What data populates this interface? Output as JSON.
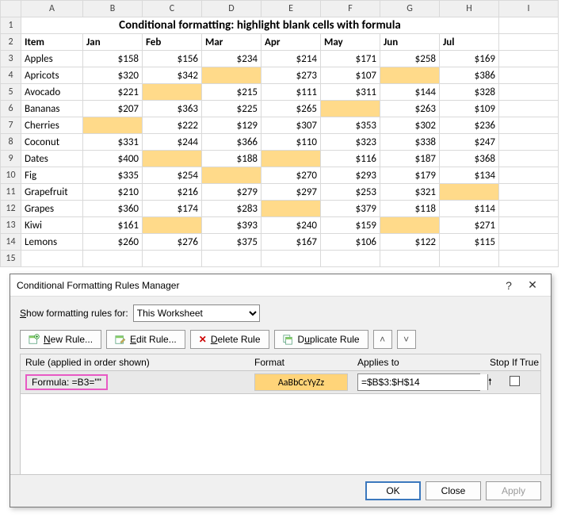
{
  "sheet": {
    "title": "Conditional formatting: highlight blank cells with formula",
    "col_letters": [
      "A",
      "B",
      "C",
      "D",
      "E",
      "F",
      "G",
      "H",
      "I"
    ],
    "row_numbers": [
      1,
      2,
      3,
      4,
      5,
      6,
      7,
      8,
      9,
      10,
      11,
      12,
      13,
      14,
      15
    ],
    "headers": {
      "item": "Item",
      "months": [
        "Jan",
        "Feb",
        "Mar",
        "Apr",
        "May",
        "Jun",
        "Jul"
      ]
    },
    "rows": [
      {
        "item": "Apples",
        "vals": [
          "$158",
          "$156",
          "$234",
          "$214",
          "$171",
          "$258",
          "$169"
        ]
      },
      {
        "item": "Apricots",
        "vals": [
          "$320",
          "$342",
          "",
          "$273",
          "$107",
          "",
          "$386"
        ]
      },
      {
        "item": "Avocado",
        "vals": [
          "$221",
          "",
          "$215",
          "$111",
          "$311",
          "$144",
          "$328"
        ]
      },
      {
        "item": "Bananas",
        "vals": [
          "$207",
          "$363",
          "$225",
          "$265",
          "",
          "$263",
          "$109"
        ]
      },
      {
        "item": "Cherries",
        "vals": [
          "",
          "$222",
          "$129",
          "$307",
          "$353",
          "$302",
          "$236"
        ]
      },
      {
        "item": "Coconut",
        "vals": [
          "$331",
          "$244",
          "$366",
          "$110",
          "$323",
          "$338",
          "$247"
        ]
      },
      {
        "item": "Dates",
        "vals": [
          "$400",
          "",
          "$188",
          "",
          "$116",
          "$187",
          "$368"
        ]
      },
      {
        "item": "Fig",
        "vals": [
          "$335",
          "$254",
          "",
          "$270",
          "$293",
          "$179",
          "$134"
        ]
      },
      {
        "item": "Grapefruit",
        "vals": [
          "$210",
          "$216",
          "$279",
          "$297",
          "$253",
          "$321",
          ""
        ]
      },
      {
        "item": "Grapes",
        "vals": [
          "$360",
          "$174",
          "$283",
          "",
          "$379",
          "$118",
          "$114"
        ]
      },
      {
        "item": "Kiwi",
        "vals": [
          "$161",
          "",
          "$393",
          "$240",
          "$159",
          "",
          "$271"
        ]
      },
      {
        "item": "Lemons",
        "vals": [
          "$260",
          "$276",
          "$375",
          "$167",
          "$106",
          "$122",
          "$115"
        ]
      }
    ]
  },
  "dialog": {
    "title": "Conditional Formatting Rules Manager",
    "show_label_pre": "S",
    "show_label_mid": "how formatting rules for:",
    "scope_value": "This Worksheet",
    "buttons": {
      "new": "New Rule...",
      "edit": "Edit Rule...",
      "delete": "Delete Rule",
      "duplicate": "Duplicate Rule"
    },
    "columns": {
      "rule": "Rule (applied in order shown)",
      "format": "Format",
      "applies": "Applies to",
      "stop": "Stop If True"
    },
    "rule": {
      "formula_text": "Formula: =B3=\"\"",
      "format_preview": "AaBbCcYyZz",
      "applies_to": "=$B$3:$H$14"
    },
    "footer": {
      "ok": "OK",
      "close": "Close",
      "apply": "Apply"
    }
  }
}
